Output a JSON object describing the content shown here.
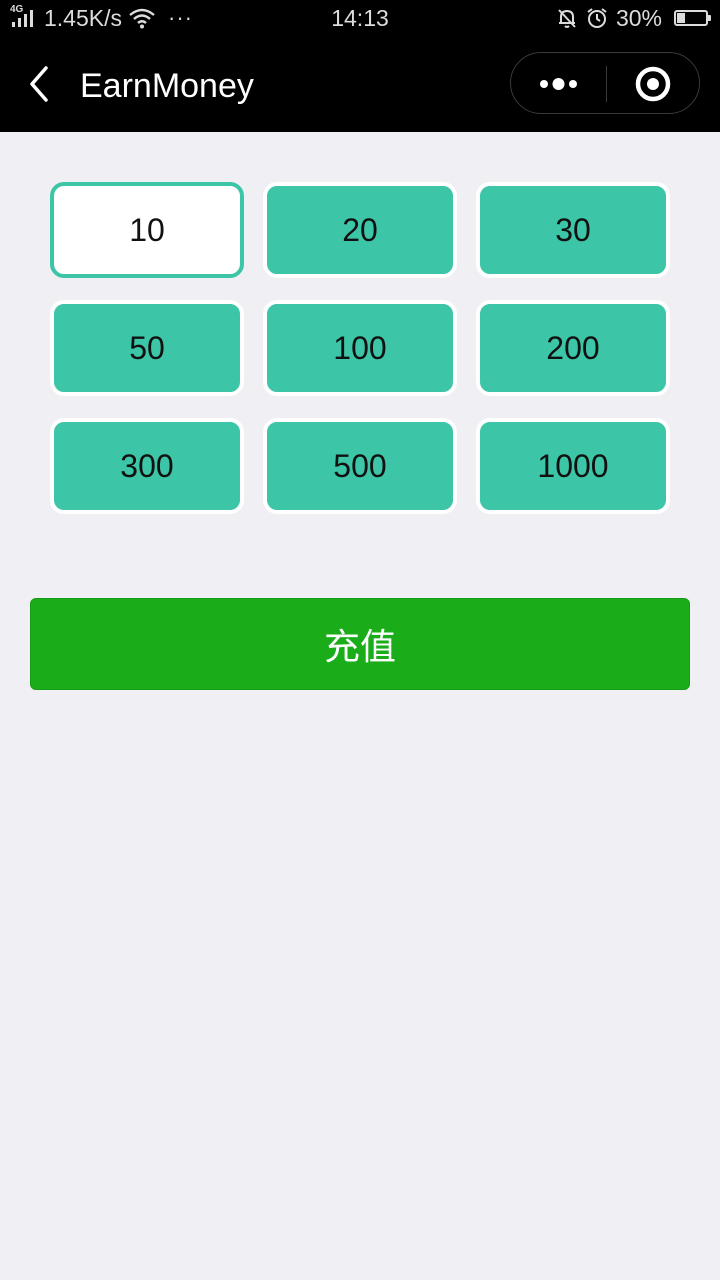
{
  "status_bar": {
    "network_type": "4G",
    "speed": "1.45K/s",
    "more": "···",
    "time": "14:13",
    "battery_percent": "30%",
    "battery_level": 0.3
  },
  "nav": {
    "title": "EarnMoney"
  },
  "amounts": [
    {
      "label": "10",
      "selected": true
    },
    {
      "label": "20",
      "selected": false
    },
    {
      "label": "30",
      "selected": false
    },
    {
      "label": "50",
      "selected": false
    },
    {
      "label": "100",
      "selected": false
    },
    {
      "label": "200",
      "selected": false
    },
    {
      "label": "300",
      "selected": false
    },
    {
      "label": "500",
      "selected": false
    },
    {
      "label": "1000",
      "selected": false
    }
  ],
  "recharge_button": {
    "label": "充值"
  },
  "colors": {
    "accent_teal": "#3cc5a6",
    "button_green": "#1aad19",
    "page_background": "#efeff4",
    "bar_background": "#000000"
  },
  "icons": {
    "back": "chevron-left-icon",
    "more": "more-dots-icon",
    "close": "target-close-icon",
    "signal": "cellular-signal-icon",
    "wifi": "wifi-icon",
    "mute": "bell-off-icon",
    "alarm": "alarm-clock-icon",
    "battery": "battery-icon"
  }
}
